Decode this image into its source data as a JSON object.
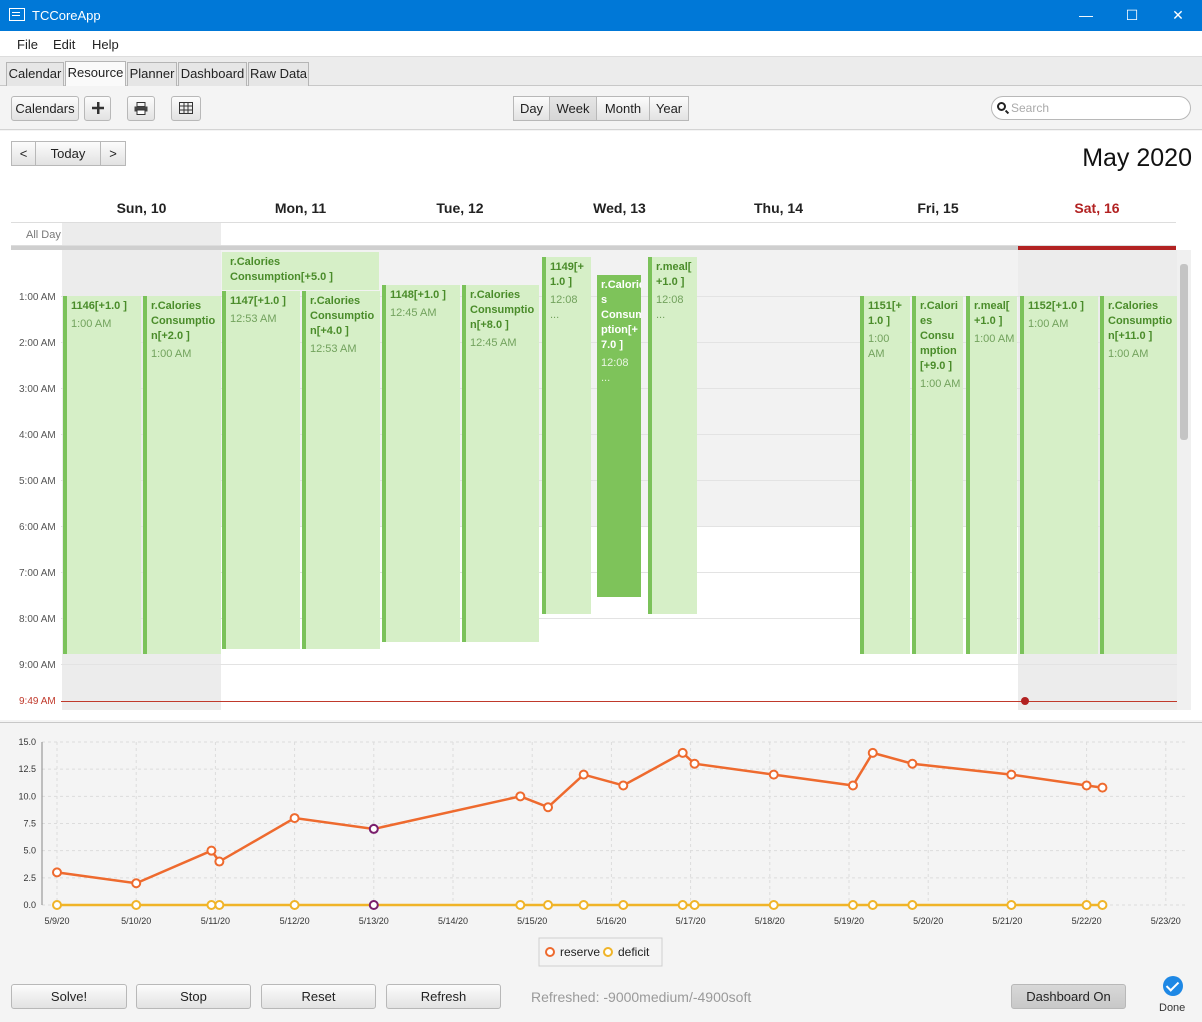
{
  "window": {
    "title": "TCCoreApp",
    "minimize": "—",
    "maximize": "☐",
    "close": "✕"
  },
  "menu": [
    "File",
    "Edit",
    "Help"
  ],
  "tabs": [
    "Calendar",
    "Resource",
    "Planner",
    "Dashboard",
    "Raw Data"
  ],
  "active_tab": "Resource",
  "toolbar": {
    "calendars_label": "Calendars",
    "add_icon": "plus-icon",
    "print_icon": "printer-icon",
    "table_icon": "table-icon",
    "views": [
      "Day",
      "Week",
      "Month",
      "Year"
    ],
    "selected_view": "Week",
    "search_placeholder": "Search"
  },
  "calendar": {
    "prev": "<",
    "today": "Today",
    "next": ">",
    "title": "May 2020",
    "days": [
      "Sun, 10",
      "Mon, 11",
      "Tue, 12",
      "Wed, 13",
      "Thu, 14",
      "Fri, 15",
      "Sat, 16"
    ],
    "today_day": "Sat, 16",
    "all_day_label": "All Day",
    "hours": [
      "1:00 AM",
      "2:00 AM",
      "3:00 AM",
      "4:00 AM",
      "5:00 AM",
      "6:00 AM",
      "7:00 AM",
      "8:00 AM",
      "9:00 AM"
    ],
    "now_label": "9:49 AM",
    "events": [
      {
        "title": "1146[+1.0 ]",
        "time": "1:00 AM"
      },
      {
        "title": "r.Calories Consumptio n[+2.0 ]",
        "time": "1:00 AM"
      },
      {
        "title": "r.Calories Consumption[+5.0 ]",
        "time": ""
      },
      {
        "title": "1147[+1.0 ]",
        "time": "12:53 AM"
      },
      {
        "title": "r.Calories Consumptio n[+4.0 ]",
        "time": "12:53 AM"
      },
      {
        "title": "1148[+1.0 ]",
        "time": "12:45 AM"
      },
      {
        "title": "r.Calories Consumptio n[+8.0 ]",
        "time": "12:45 AM"
      },
      {
        "title": "1149[+ 1.0 ]",
        "time": "12:08 ..."
      },
      {
        "title": "r.Calorie s Consum ption[+ 7.0 ]",
        "time": "12:08 ..."
      },
      {
        "title": "r.meal[ +1.0 ]",
        "time": "12:08 ..."
      },
      {
        "title": "1151[+ 1.0 ]",
        "time": "1:00 AM"
      },
      {
        "title": "r.Calori es Consu mption [+9.0 ]",
        "time": "1:00 AM"
      },
      {
        "title": "r.meal[ +1.0 ]",
        "time": "1:00 AM"
      },
      {
        "title": "1152[+1.0 ]",
        "time": "1:00 AM"
      },
      {
        "title": "r.Calories Consumptio n[+11.0 ]",
        "time": "1:00 AM"
      }
    ]
  },
  "chart_data": {
    "type": "line",
    "title": "",
    "xlabel": "",
    "ylabel": "",
    "x_ticks": [
      "5/9/20",
      "5/10/20",
      "5/11/20",
      "5/12/20",
      "5/13/20",
      "5/14/20",
      "5/15/20",
      "5/16/20",
      "5/17/20",
      "5/18/20",
      "5/19/20",
      "5/20/20",
      "5/21/20",
      "5/22/20",
      "5/23/20"
    ],
    "y_ticks": [
      "0.0",
      "2.5",
      "5.0",
      "7.5",
      "10.0",
      "12.5",
      "15.0"
    ],
    "ylim": [
      0,
      15
    ],
    "xlim": [
      0,
      14.2
    ],
    "grid": true,
    "legend_position": "bottom",
    "series": [
      {
        "name": "reserve",
        "color": "#ee6a2e",
        "x": [
          0,
          1,
          1.95,
          2.05,
          3,
          4,
          5.85,
          6.2,
          6.65,
          7.15,
          7.9,
          8.05,
          9.05,
          10.05,
          10.3,
          10.8,
          12.05,
          13,
          13.2
        ],
        "y": [
          3,
          2,
          5,
          4,
          8,
          7,
          10,
          9,
          12,
          11,
          14,
          13,
          12,
          11,
          14,
          13,
          12,
          11,
          10.8
        ]
      },
      {
        "name": "deficit",
        "color": "#f0b428",
        "x": [
          0,
          1,
          1.95,
          2.05,
          3,
          4,
          5.85,
          6.2,
          6.65,
          7.15,
          7.9,
          8.05,
          9.05,
          10.05,
          10.3,
          10.8,
          12.05,
          13,
          13.2
        ],
        "y": [
          0,
          0,
          0,
          0,
          0,
          0,
          0,
          0,
          0,
          0,
          0,
          0,
          0,
          0,
          0,
          0,
          0,
          0,
          0
        ]
      }
    ],
    "highlight_color": "#7a1e6c"
  },
  "bottom": {
    "solve": "Solve!",
    "stop": "Stop",
    "reset": "Reset",
    "refresh": "Refresh",
    "status": "Refreshed: -9000medium/-4900soft",
    "dashboard": "Dashboard On",
    "done": "Done"
  }
}
